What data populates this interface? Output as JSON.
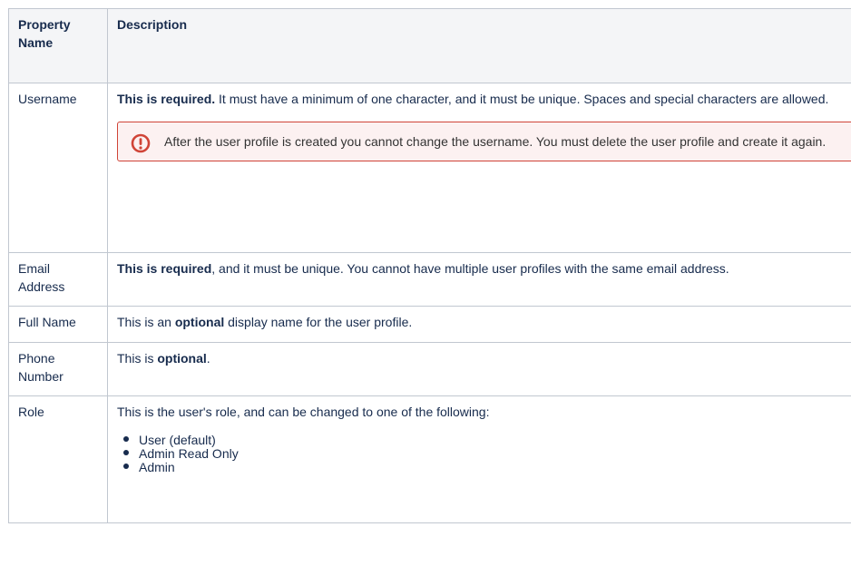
{
  "table": {
    "header": {
      "name_line1": "Property",
      "name_line2": "Name",
      "description": "Description"
    },
    "rows": {
      "username": {
        "name": "Username",
        "desc_bold": "This is required.",
        "desc_rest": "  It must have a minimum of one character, and it must be unique.  Spaces and special characters are allowed.",
        "error_icon": "error-exclamation-icon",
        "error_text": "After the user profile is created you cannot change the username.  You must delete the user profile and create it again."
      },
      "email": {
        "name_line1": "Email",
        "name_line2": "Address",
        "desc_bold": "This is required",
        "desc_rest": ", and it must be unique.  You cannot have multiple user profiles with the same email address."
      },
      "full_name": {
        "name": "Full Name",
        "desc_pre": "This is an ",
        "desc_bold": "optional",
        "desc_post": " display name for the user profile."
      },
      "phone": {
        "name_line1": "Phone",
        "name_line2": "Number",
        "desc_pre": "This is ",
        "desc_bold": "optional",
        "desc_post": "."
      },
      "role": {
        "name": "Role",
        "desc": "This is the user's role, and can be changed to one of the following:",
        "options": [
          "User (default)",
          "Admin Read Only",
          "Admin"
        ]
      }
    }
  },
  "colors": {
    "border": "#c1c7d0",
    "header_bg": "#f4f5f7",
    "error_border": "#d04437",
    "error_bg": "#fcf1f1"
  }
}
